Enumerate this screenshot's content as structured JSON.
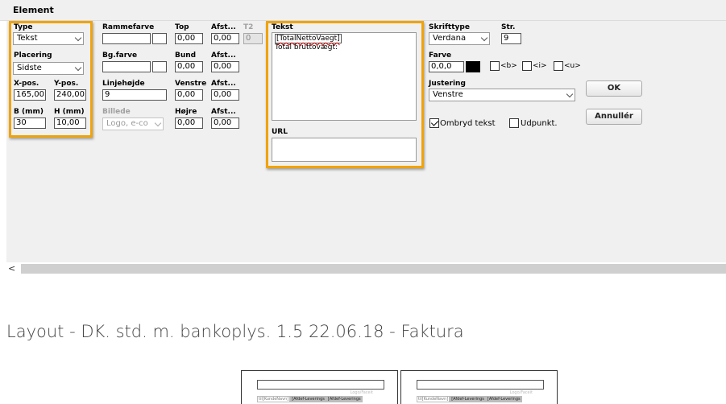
{
  "header": {
    "title": "Element"
  },
  "col1": {
    "type_label": "Type",
    "type_value": "Tekst",
    "placering_label": "Placering",
    "placering_value": "Sidste",
    "xpos_label": "X-pos.",
    "xpos_value": "165,00",
    "ypos_label": "Y-pos.",
    "ypos_value": "240,00",
    "b_label": "B (mm)",
    "b_value": "30",
    "h_label": "H (mm)",
    "h_value": "10,00"
  },
  "col2": {
    "rammefarve_label": "Rammefarve",
    "bgfarve_label": "Bg.farve",
    "linjehoejde_label": "Linjehøjde",
    "linjehoejde_value": "9",
    "billede_label": "Billede",
    "billede_value": "Logo, e-co"
  },
  "col3": {
    "top_label": "Top",
    "top_value": "0,00",
    "afst1_label": "Afst...",
    "afst1_value": "0,00",
    "t2_label": "T2",
    "t2_value": "0",
    "bund_label": "Bund",
    "bund_value": "0,00",
    "afst2_label": "Afst...",
    "afst2_value": "0,00",
    "venstre_label": "Venstre",
    "venstre_value": "0,00",
    "afst3_label": "Afst...",
    "afst3_value": "0,00",
    "hoejre_label": "Højre",
    "hoejre_value": "0,00",
    "afst4_label": "Afst...",
    "afst4_value": "0,00"
  },
  "text_section": {
    "tekst_label": "Tekst",
    "tekst_line1": "[TotalNettoVaegt]",
    "tekst_line2": "Total bruttovægt:",
    "url_label": "URL",
    "url_value": ""
  },
  "col5": {
    "skrifttype_label": "Skrifttype",
    "skrifttype_value": "Verdana",
    "str_label": "Str.",
    "str_value": "9",
    "farve_label": "Farve",
    "farve_value": "0,0,0",
    "bold_label": "<b>",
    "italic_label": "<i>",
    "underline_label": "<u>",
    "justering_label": "Justering",
    "justering_value": "Venstre",
    "ombryd_label": "Ombryd tekst",
    "udpunkt_label": "Udpunkt."
  },
  "buttons": {
    "ok": "OK",
    "annuller": "Annullér"
  },
  "scroll": {
    "left_arrow": "<"
  },
  "layout_title": "Layout - DK. std. m. bankoplys. 1.5 22.06.18 - Faktura",
  "thumbnails": [
    {
      "logo": "Logo/Faceit",
      "cells": [
        "til[KundeNavn]",
        "[Afdef-Leverings",
        "[Afdef-Leverings"
      ]
    },
    {
      "logo": "Logo/Faceit",
      "cells": [
        "til[KundeNavn]",
        "[Afdef-Leverings",
        "[Afdef-Leverings"
      ]
    }
  ],
  "colors": {
    "highlight": "#f0a30a",
    "swatch": "#000000"
  }
}
